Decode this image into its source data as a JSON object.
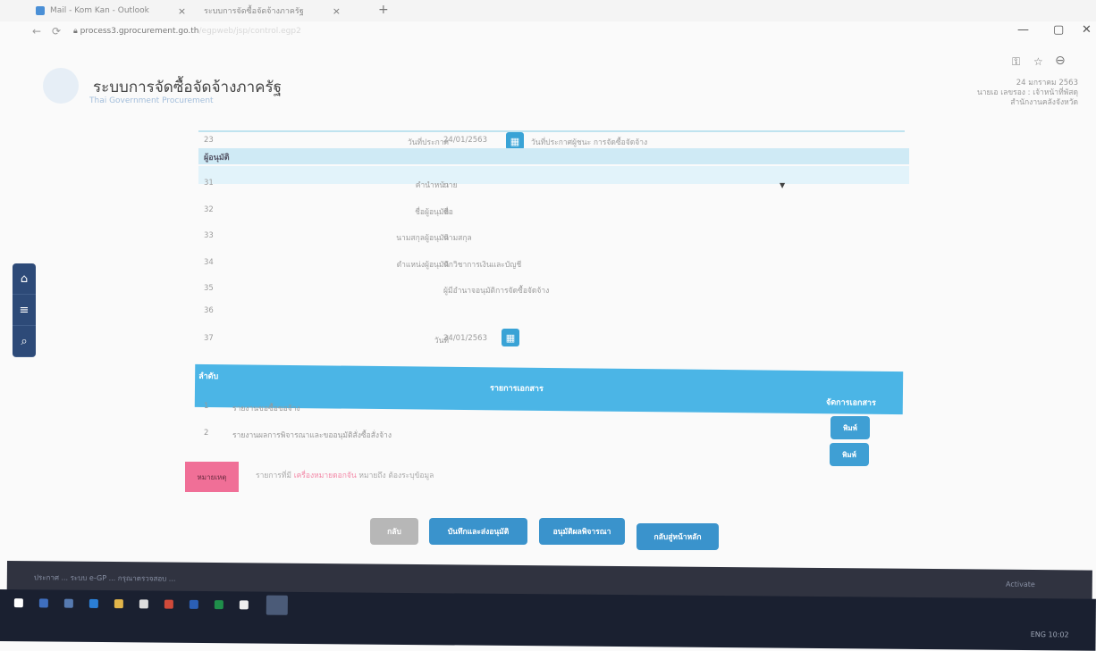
{
  "browser": {
    "tabs": [
      {
        "title": "Mail - Kom Kan - Outlook"
      },
      {
        "title": "ระบบการจัดซื้อจัดจ้างภาครัฐ"
      }
    ],
    "url": "process3.gprocurement.go.th",
    "url_faint": "/egpweb/jsp/control.egp2"
  },
  "site": {
    "title": "ระบบการจัดซื้อจัดจ้างภาครัฐ",
    "subtitle": "Thai Government Procurement",
    "user_lines": [
      "24 มกราคม 2563",
      "นายเอ เลขรอง : เจ้าหน้าที่พัสดุ",
      "สำนักงานคลังจังหวัด"
    ]
  },
  "form": {
    "top_row": {
      "num": "23",
      "label": "วันที่ประกาศ",
      "date": "24/01/2563",
      "note": "วันที่ประกาศผู้ชนะ การจัดซื้อจัดจ้าง"
    },
    "section_label": "ผู้อนุมัติ",
    "rows": [
      {
        "num": "31",
        "label": "คำนำหน้า",
        "value": "นาย"
      },
      {
        "num": "32",
        "label": "ชื่อผู้อนุมัติ",
        "value": "ชื่อ"
      },
      {
        "num": "33",
        "label": "นามสกุลผู้อนุมัติ",
        "value": "นามสกุล"
      },
      {
        "num": "34",
        "label": "ตำแหน่งผู้อนุมัติ",
        "value": "นักวิชาการเงินและบัญชี"
      },
      {
        "num": "35",
        "label": "",
        "value": "ผู้มีอำนาจอนุมัติการจัดซื้อจัดจ้าง"
      },
      {
        "num": "36",
        "label": "",
        "value": ""
      },
      {
        "num": "37",
        "label": "วันที่",
        "value": "24/01/2563"
      }
    ]
  },
  "documents": {
    "headers": {
      "no": "ลำดับ",
      "name": "รายการเอกสาร",
      "action": "จัดการเอกสาร"
    },
    "rows": [
      {
        "no": "1",
        "name": "รายงานขอซื้อขอจ้าง",
        "action": "พิมพ์"
      },
      {
        "no": "2",
        "name": "รายงานผลการพิจารณาและขออนุมัติสั่งซื้อสั่งจ้าง",
        "action": "พิมพ์"
      }
    ]
  },
  "remark": {
    "badge": "หมายเหตุ",
    "text_prefix": "รายการที่มี",
    "text_red": "เครื่องหมายดอกจัน",
    "text_suffix": "หมายถึง ต้องระบุข้อมูล"
  },
  "actions": {
    "back": "กลับ",
    "save": "บันทึกและส่งอนุมัติ",
    "approve": "อนุมัติผลพิจารณา",
    "main": "กลับสู่หน้าหลัก"
  },
  "taskbar": {
    "notification": "ประกาศ ... ระบบ e-GP ... กรุณาตรวจสอบ ...",
    "status": "Activate",
    "tray_text": "ENG 10:02"
  },
  "colors": {
    "primary": "#3a93cc",
    "header_bar": "#4bb5e6",
    "section_bg": "#cfeaf5",
    "remark_pink": "#f06f97",
    "nav_dark": "#2d4a78"
  }
}
